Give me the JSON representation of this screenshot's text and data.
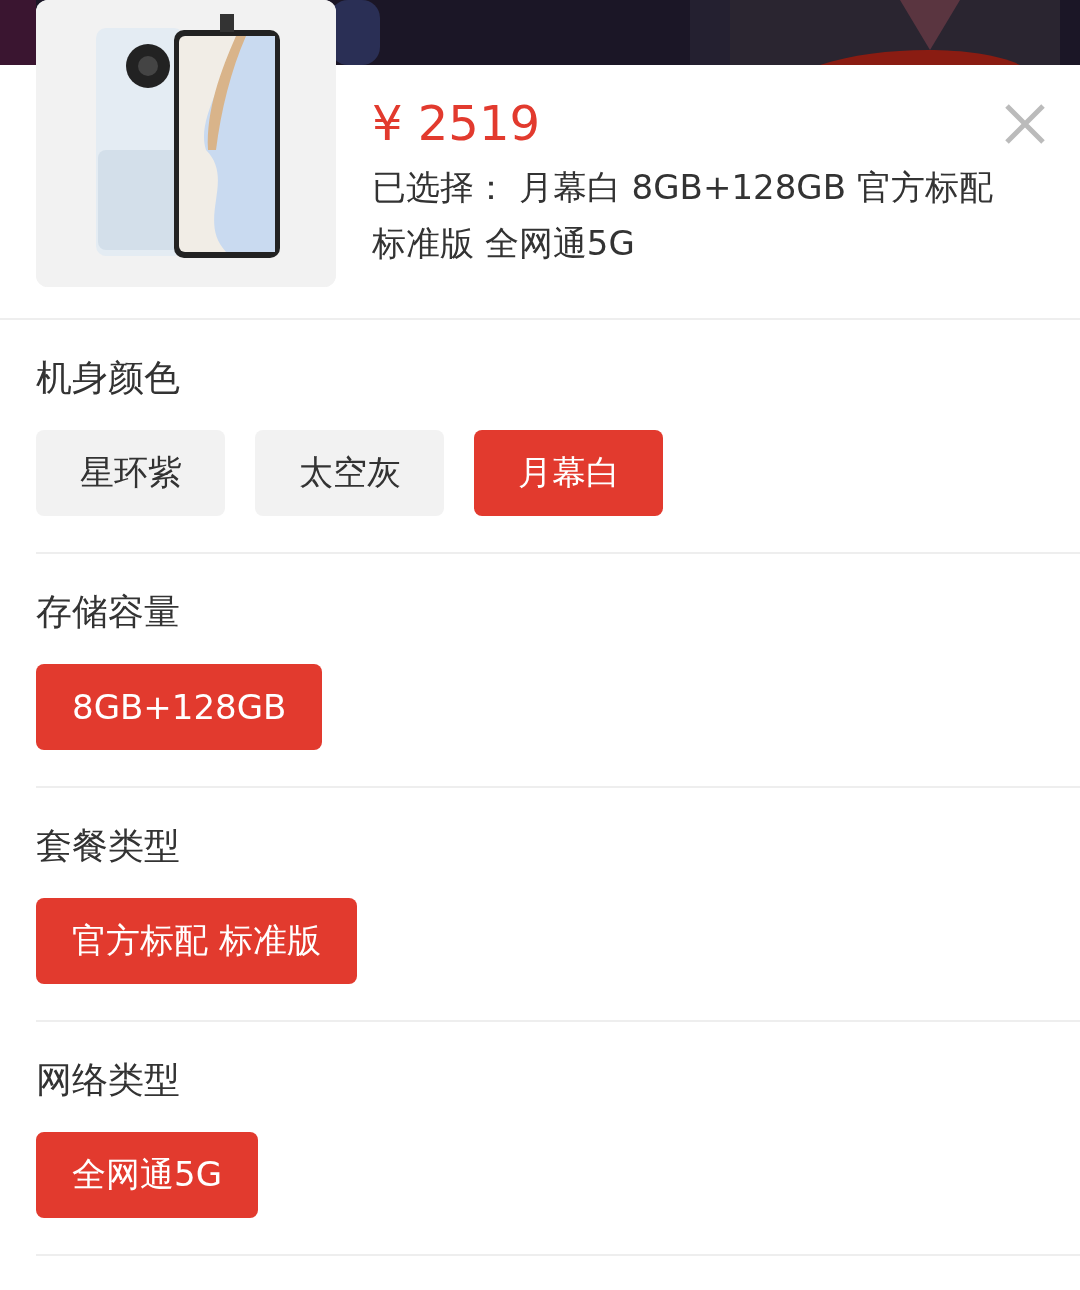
{
  "product": {
    "price": "¥ 2519",
    "selected_summary": "已选择：  月幕白 8GB+128GB 官方标配标准版 全网通5G"
  },
  "sections": [
    {
      "title": "机身颜色",
      "options": [
        {
          "label": "星环紫",
          "selected": false
        },
        {
          "label": "太空灰",
          "selected": false
        },
        {
          "label": "月幕白",
          "selected": true
        }
      ]
    },
    {
      "title": "存储容量",
      "options": [
        {
          "label": "8GB+128GB",
          "selected": true
        }
      ]
    },
    {
      "title": "套餐类型",
      "options": [
        {
          "label": "官方标配 标准版",
          "selected": true
        }
      ]
    },
    {
      "title": "网络类型",
      "options": [
        {
          "label": "全网通5G",
          "selected": true
        }
      ]
    }
  ]
}
